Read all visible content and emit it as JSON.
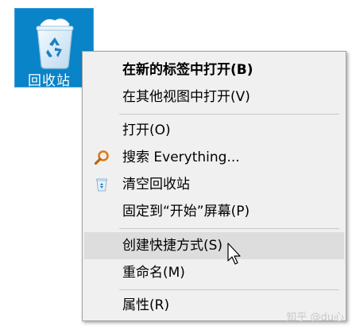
{
  "desktop_icon": {
    "label": "回收站",
    "icon": "recycle-bin-icon",
    "selected": true,
    "highlight_color": "#0a84c8"
  },
  "context_menu": {
    "items": [
      {
        "label": "在新的标签中打开(B)",
        "bold": true,
        "icon": null
      },
      {
        "label": "在其他视图中打开(V)",
        "bold": false,
        "icon": null
      },
      {
        "label": "打开(O)",
        "bold": false,
        "icon": null
      },
      {
        "label": "搜索 Everything...",
        "bold": false,
        "icon": "everything-search-icon"
      },
      {
        "label": "清空回收站",
        "bold": false,
        "icon": "recycle-bin-icon"
      },
      {
        "label": "固定到“开始”屏幕(P)",
        "bold": false,
        "icon": null
      },
      {
        "label": "创建快捷方式(S)",
        "bold": false,
        "icon": null,
        "hovered": true
      },
      {
        "label": "重命名(M)",
        "bold": false,
        "icon": null
      },
      {
        "label": "属性(R)",
        "bold": false,
        "icon": null
      }
    ],
    "hover_color": "#dddddd",
    "background_color": "#f0f0f0"
  },
  "watermark": {
    "text": "知乎 @du心"
  }
}
